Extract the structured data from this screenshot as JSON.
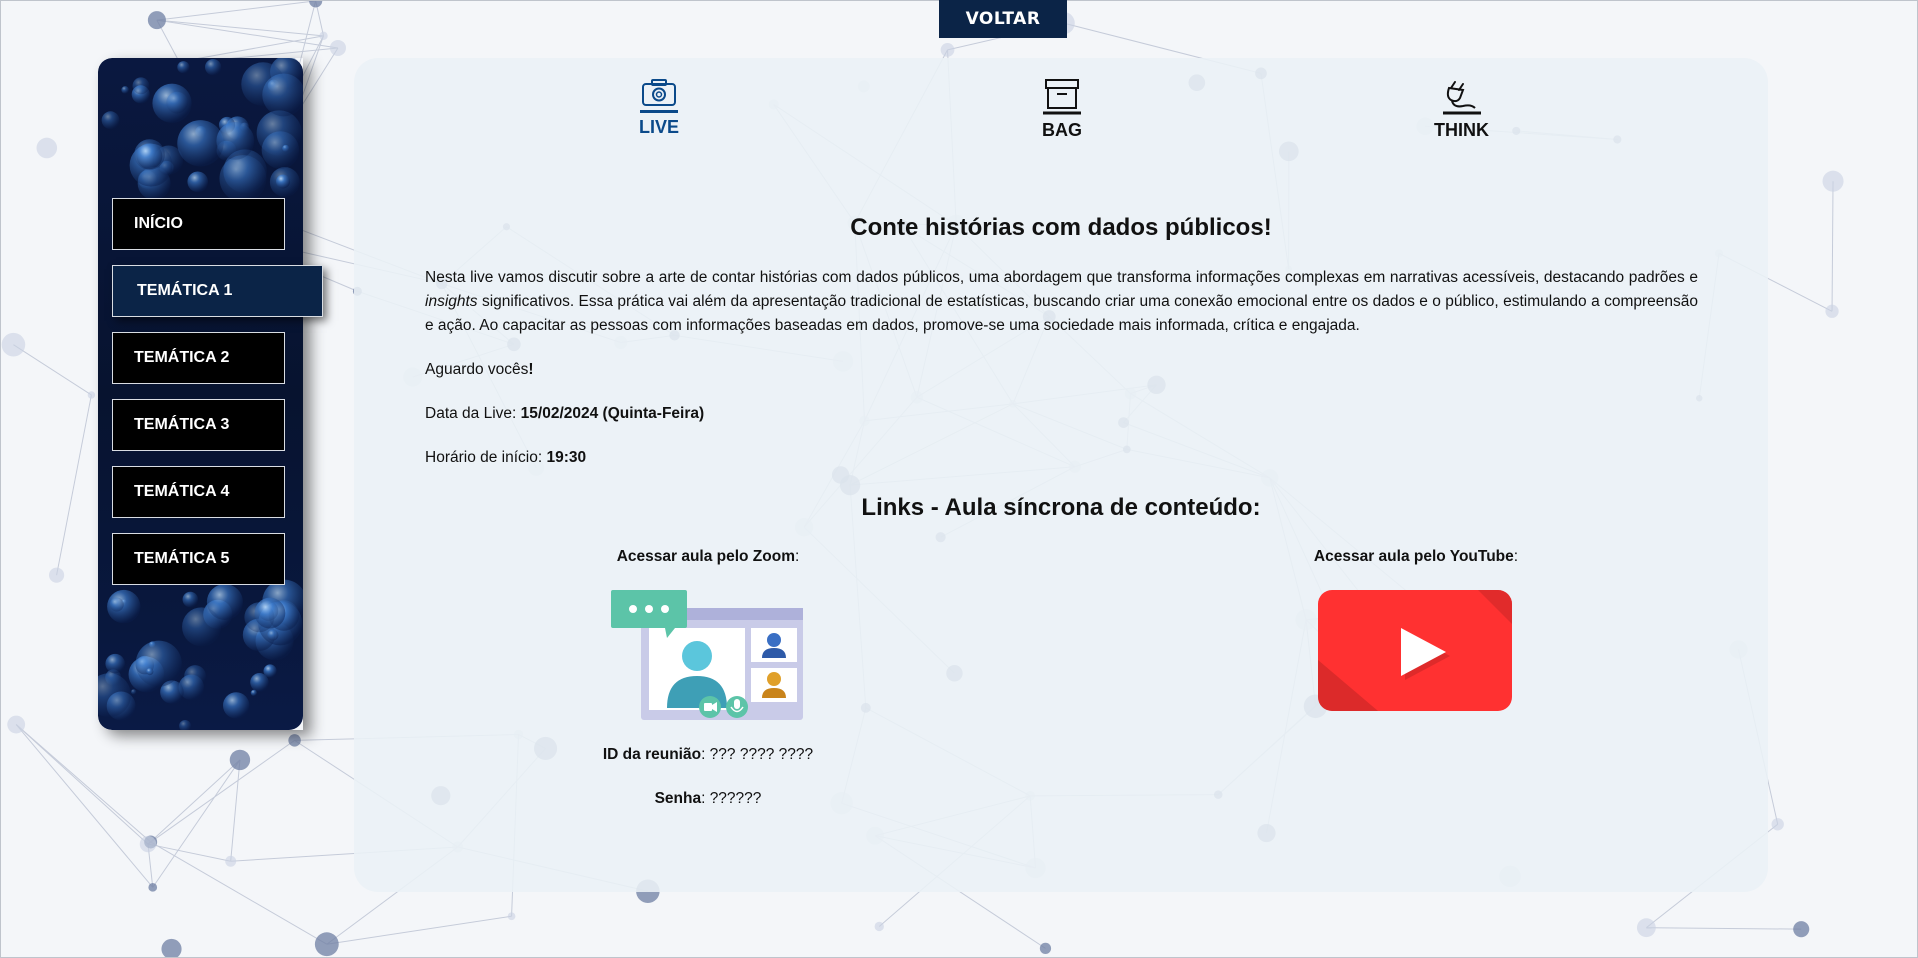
{
  "header": {
    "back_label": "VOLTAR"
  },
  "sidebar": {
    "items": [
      {
        "label": "INÍCIO",
        "active": false
      },
      {
        "label": "TEMÁTICA 1",
        "active": true
      },
      {
        "label": "TEMÁTICA 2",
        "active": false
      },
      {
        "label": "TEMÁTICA 3",
        "active": false
      },
      {
        "label": "TEMÁTICA 4",
        "active": false
      },
      {
        "label": "TEMÁTICA 5",
        "active": false
      }
    ]
  },
  "tabs": [
    {
      "label": "LIVE",
      "icon": "camera-icon",
      "active": true
    },
    {
      "label": "BAG",
      "icon": "archive-box-icon",
      "active": false
    },
    {
      "label": "THINK",
      "icon": "plug-icon",
      "active": false
    }
  ],
  "main": {
    "title": "Conte histórias com dados públicos!",
    "intro": {
      "part1": "Nesta live vamos discutir sobre a arte de contar histórias com dados públicos, uma abordagem que transforma informações complexas em narrativas acessíveis, destacando padrões e ",
      "emphasis": "insights",
      "part2": " significativos. Essa prática vai além da apresentação tradicional de estatísticas, buscando criar uma conexão emocional entre os dados e o público, estimulando a compreensão e ação. Ao capacitar as pessoas com informações baseadas em dados, promove-se uma sociedade mais informada, crítica e engajada."
    },
    "greeting_text": "Aguardo vocês",
    "greeting_mark": "!",
    "date_label": "Data da Live: ",
    "date_value": "15/02/2024 (Quinta-Feira)",
    "time_label": "Horário de início: ",
    "time_value": "19:30",
    "links_title": "Links - Aula síncrona de conteúdo:",
    "zoom": {
      "label": "Acessar aula pelo Zoom",
      "suffix": ":",
      "meeting_id_label": "ID da reunião",
      "meeting_id_value": ": ??? ???? ????",
      "password_label": "Senha",
      "password_value": ": ??????"
    },
    "youtube": {
      "label": "Acessar aula pelo YouTube",
      "suffix": ":"
    }
  },
  "colors": {
    "navy": "#0b2447",
    "accent_blue": "#0b4a8a",
    "youtube_red": "#ff3131",
    "zoom_green": "#5cc4a8",
    "panel_bg": "#eaf1f6"
  }
}
